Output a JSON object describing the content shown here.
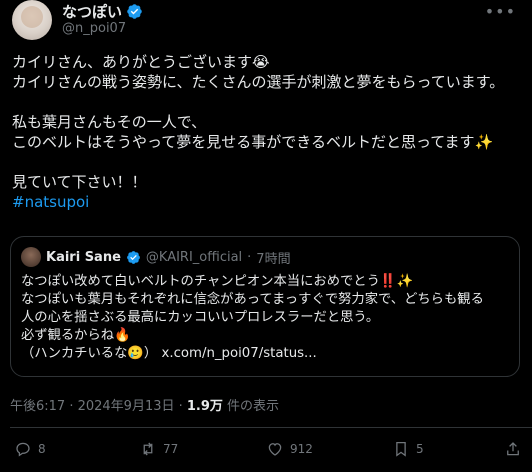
{
  "author": {
    "name": "なつぽい",
    "handle": "@n_poi07"
  },
  "tweet": {
    "lines": [
      "カイリさん、ありがとうございます😭",
      "カイリさんの戦う姿勢に、たくさんの選手が刺激と夢をもらっています。",
      "私も葉月さんもその一人で、",
      "このベルトはそうやって夢を見せる事ができるベルトだと思ってます✨",
      "見ていて下さい！！"
    ],
    "hashtag": "#natsupoi"
  },
  "quote": {
    "name": "Kairi Sane",
    "handle": "@KAIRI_official",
    "dot": "·",
    "time": "7時間",
    "lines": [
      "なつぽい改めて白いベルトのチャンピオン本当におめでとう‼️✨",
      "なつぽいも葉月もそれぞれに信念があってまっすぐで努力家で、どちらも観る",
      "人の心を揺さぶる最高にカッコいいプロレスラーだと思う。",
      "必ず観るからね🔥",
      "（ハンカチいるな🥲）"
    ],
    "link": "x.com/n_poi07/status..."
  },
  "meta": {
    "time": "午後6:17 · 2024年9月13日 · ",
    "views_count": "1.9万",
    "views_label": " 件の表示"
  },
  "actions": {
    "reply_count": "8",
    "retweet_count": "77",
    "like_count": "912",
    "bookmark_count": "5"
  },
  "colors": {
    "background": "#000000",
    "text": "#e7e9ea",
    "muted": "#71767b",
    "link": "#1d9bf0",
    "border": "#2f3336"
  }
}
